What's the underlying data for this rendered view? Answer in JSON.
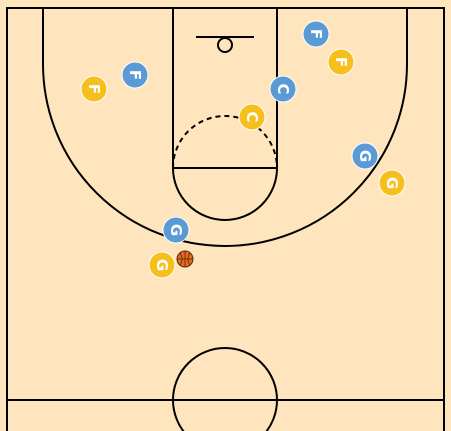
{
  "colors": {
    "court": "#ffe5bd",
    "lines": "#000000",
    "offense_team": "#f5bf1d",
    "defense_team": "#5b9bd5",
    "ball": "#e36a1e"
  },
  "players": [
    {
      "label": "F",
      "team": "offense"
    },
    {
      "label": "F",
      "team": "offense"
    },
    {
      "label": "C",
      "team": "offense"
    },
    {
      "label": "G",
      "team": "offense"
    },
    {
      "label": "G",
      "team": "offense"
    },
    {
      "label": "F",
      "team": "defense"
    },
    {
      "label": "F",
      "team": "defense"
    },
    {
      "label": "C",
      "team": "defense"
    },
    {
      "label": "G",
      "team": "defense"
    },
    {
      "label": "G",
      "team": "defense"
    }
  ],
  "ball": {
    "holder": "offense-player-5"
  },
  "icons": {
    "ball": "basketball-icon"
  }
}
